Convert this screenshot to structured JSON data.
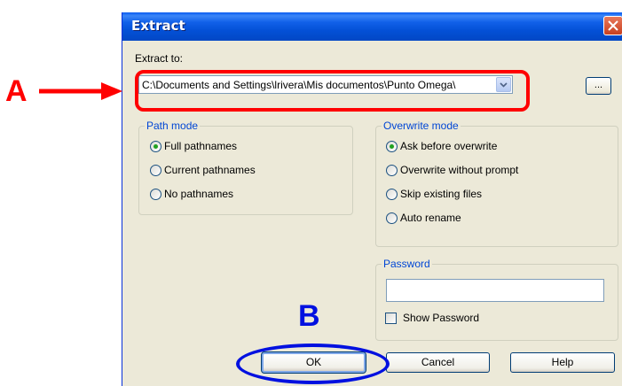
{
  "window": {
    "title": "Extract"
  },
  "extract": {
    "label": "Extract to:",
    "path_value": "C:\\Documents and Settings\\lrivera\\Mis documentos\\Punto Omega\\",
    "browse_label": "..."
  },
  "path_mode": {
    "legend": "Path mode",
    "options": [
      "Full pathnames",
      "Current pathnames",
      "No pathnames"
    ],
    "selected": "Full pathnames"
  },
  "overwrite_mode": {
    "legend": "Overwrite mode",
    "options": [
      "Ask before overwrite",
      "Overwrite without prompt",
      "Skip existing files",
      "Auto rename"
    ],
    "selected": "Ask before overwrite"
  },
  "password": {
    "legend": "Password",
    "value": "",
    "show_label": "Show Password",
    "show_checked": false
  },
  "buttons": {
    "ok": "OK",
    "cancel": "Cancel",
    "help": "Help"
  },
  "annotations": {
    "a_label": "A",
    "a_color": "#ff0000",
    "b_label": "B",
    "b_color": "#0010e0"
  },
  "colors": {
    "title_bar": "#0350d6",
    "dialog_bg": "#ece9d8",
    "group_legend": "#0046d5"
  }
}
